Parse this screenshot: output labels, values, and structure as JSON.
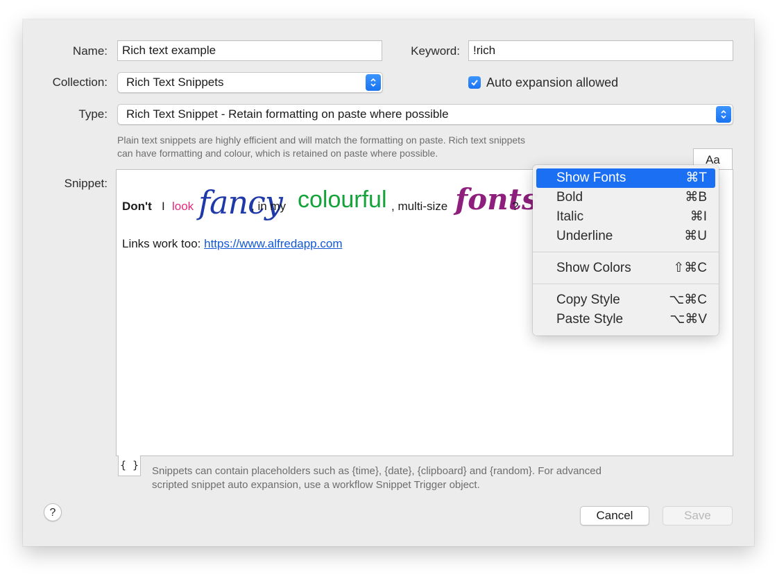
{
  "form": {
    "name_label": "Name:",
    "name_value": "Rich text example",
    "keyword_label": "Keyword:",
    "keyword_value": "!rich",
    "collection_label": "Collection:",
    "collection_value": "Rich Text Snippets",
    "auto_expansion_label": "Auto expansion allowed",
    "auto_expansion_checked": true,
    "type_label": "Type:",
    "type_value": "Rich Text Snippet -  Retain formatting on paste where possible",
    "type_hint_line1": "Plain text snippets are highly efficient and will match the formatting on paste. Rich text snippets",
    "type_hint_line2": "can have formatting and colour, which is retained on paste where possible.",
    "snippet_label": "Snippet:",
    "font_button_label": "Aa"
  },
  "snippet": {
    "w1": "Don't",
    "w2": "I",
    "w3": "look",
    "w4": "fancy",
    "w5": ", in my",
    "w6": "colourful",
    "w7": ", multi-size",
    "w8": "fonts",
    "w9": "?",
    "link_prefix": "Links work too: ",
    "link_text": "https://www.alfredapp.com",
    "colors": {
      "look": "#e6287d",
      "fancy": "#1f3aa8",
      "colourful": "#14a33a",
      "fonts": "#8e1f7c",
      "link": "#1258d6"
    }
  },
  "footer": {
    "placeholder_button": "{ }",
    "note_line1": "Snippets can contain placeholders such as {time}, {date}, {clipboard} and {random}. For advanced",
    "note_line2": "scripted snippet auto expansion, use a workflow Snippet Trigger object.",
    "help": "?",
    "cancel": "Cancel",
    "save": "Save"
  },
  "context_menu": {
    "items": [
      {
        "label": "Show Fonts",
        "shortcut": "⌘T",
        "selected": true
      },
      {
        "label": "Bold",
        "shortcut": "⌘B"
      },
      {
        "label": "Italic",
        "shortcut": "⌘I"
      },
      {
        "label": "Underline",
        "shortcut": "⌘U"
      },
      {
        "label": "Show Colors",
        "shortcut": "⇧⌘C"
      },
      {
        "label": "Copy Style",
        "shortcut": "⌥⌘C"
      },
      {
        "label": "Paste Style",
        "shortcut": "⌥⌘V"
      }
    ]
  },
  "colors": {
    "accent": "#1b6ff2",
    "sheet_bg": "#ececec"
  }
}
